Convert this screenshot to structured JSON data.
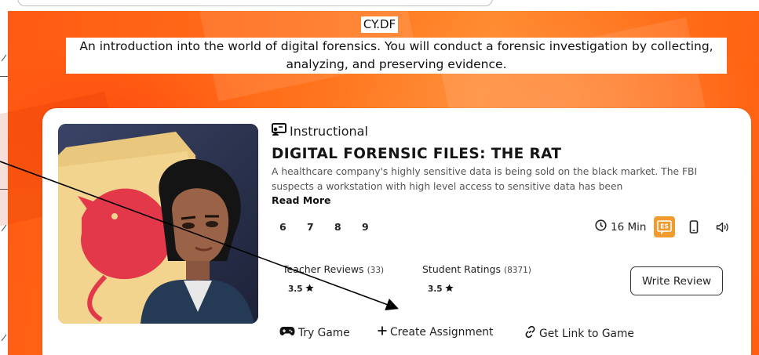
{
  "banner": {
    "course_code": "CY.DF",
    "description": "An introduction into the world of digital forensics. You will conduct a forensic investigation by collecting, analyzing, and preserving evidence."
  },
  "game": {
    "type_icon": "instructional-icon",
    "type_label": "Instructional",
    "title": "DIGITAL FORENSIC FILES: THE RAT",
    "description": "A healthcare company's highly sensitive data is being sold on the black market. The FBI suspects a workstation with high level access to sensitive data has been",
    "read_more": "Read More",
    "grades": [
      "6",
      "7",
      "8",
      "9"
    ],
    "duration": "16 Min",
    "language_badge": "ES",
    "icons": [
      "clock-icon",
      "spanish-language-icon",
      "mobile-device-icon",
      "audio-icon"
    ]
  },
  "reviews": {
    "teacher_label": "Teacher Reviews",
    "teacher_count": "(33)",
    "teacher_rating": "3.5",
    "student_label": "Student Ratings",
    "student_count": "(8371)",
    "student_rating": "3.5",
    "write_review": "Write Review"
  },
  "actions": {
    "try_game": "Try Game",
    "create_assignment": "Create Assignment",
    "get_link": "Get Link to Game"
  },
  "colors": {
    "banner_orange": "#ff6a16",
    "badge_orange": "#f29b2e",
    "card_bg": "#ffffff"
  }
}
